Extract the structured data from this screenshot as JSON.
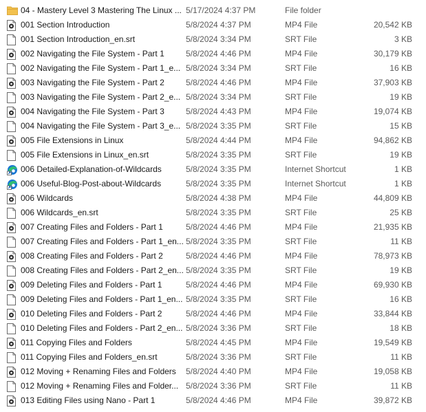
{
  "files": [
    {
      "name": "04 - Mastery Level 3 Mastering The Linux ...",
      "date": "5/17/2024 4:37 PM",
      "type": "File folder",
      "size": "",
      "icon": "folder-icon"
    },
    {
      "name": "001 Section Introduction",
      "date": "5/8/2024 4:37 PM",
      "type": "MP4 File",
      "size": "20,542 KB",
      "icon": "video-file-icon"
    },
    {
      "name": "001 Section Introduction_en.srt",
      "date": "5/8/2024 3:34 PM",
      "type": "SRT File",
      "size": "3 KB",
      "icon": "document-icon"
    },
    {
      "name": "002 Navigating the File System - Part 1",
      "date": "5/8/2024 4:46 PM",
      "type": "MP4 File",
      "size": "30,179 KB",
      "icon": "video-file-icon"
    },
    {
      "name": "002 Navigating the File System - Part 1_e...",
      "date": "5/8/2024 3:34 PM",
      "type": "SRT File",
      "size": "16 KB",
      "icon": "document-icon"
    },
    {
      "name": "003 Navigating the File System - Part 2",
      "date": "5/8/2024 4:46 PM",
      "type": "MP4 File",
      "size": "37,903 KB",
      "icon": "video-file-icon"
    },
    {
      "name": "003 Navigating the File System - Part 2_e...",
      "date": "5/8/2024 3:34 PM",
      "type": "SRT File",
      "size": "19 KB",
      "icon": "document-icon"
    },
    {
      "name": "004 Navigating the File System - Part 3",
      "date": "5/8/2024 4:43 PM",
      "type": "MP4 File",
      "size": "19,074 KB",
      "icon": "video-file-icon"
    },
    {
      "name": "004 Navigating the File System - Part 3_e...",
      "date": "5/8/2024 3:35 PM",
      "type": "SRT File",
      "size": "15 KB",
      "icon": "document-icon"
    },
    {
      "name": "005 File Extensions in Linux",
      "date": "5/8/2024 4:44 PM",
      "type": "MP4 File",
      "size": "94,862 KB",
      "icon": "video-file-icon"
    },
    {
      "name": "005 File Extensions in Linux_en.srt",
      "date": "5/8/2024 3:35 PM",
      "type": "SRT File",
      "size": "19 KB",
      "icon": "document-icon"
    },
    {
      "name": "006 Detailed-Explanation-of-Wildcards",
      "date": "5/8/2024 3:35 PM",
      "type": "Internet Shortcut",
      "size": "1 KB",
      "icon": "internet-shortcut-icon"
    },
    {
      "name": "006 Useful-Blog-Post-about-Wildcards",
      "date": "5/8/2024 3:35 PM",
      "type": "Internet Shortcut",
      "size": "1 KB",
      "icon": "internet-shortcut-icon"
    },
    {
      "name": "006 Wildcards",
      "date": "5/8/2024 4:38 PM",
      "type": "MP4 File",
      "size": "44,809 KB",
      "icon": "video-file-icon"
    },
    {
      "name": "006 Wildcards_en.srt",
      "date": "5/8/2024 3:35 PM",
      "type": "SRT File",
      "size": "25 KB",
      "icon": "document-icon"
    },
    {
      "name": "007 Creating Files and Folders - Part 1",
      "date": "5/8/2024 4:46 PM",
      "type": "MP4 File",
      "size": "21,935 KB",
      "icon": "video-file-icon"
    },
    {
      "name": "007 Creating Files and Folders - Part 1_en...",
      "date": "5/8/2024 3:35 PM",
      "type": "SRT File",
      "size": "11 KB",
      "icon": "document-icon"
    },
    {
      "name": "008 Creating Files and Folders - Part 2",
      "date": "5/8/2024 4:46 PM",
      "type": "MP4 File",
      "size": "78,973 KB",
      "icon": "video-file-icon"
    },
    {
      "name": "008 Creating Files and Folders - Part 2_en...",
      "date": "5/8/2024 3:35 PM",
      "type": "SRT File",
      "size": "19 KB",
      "icon": "document-icon"
    },
    {
      "name": "009 Deleting Files and Folders - Part 1",
      "date": "5/8/2024 4:46 PM",
      "type": "MP4 File",
      "size": "69,930 KB",
      "icon": "video-file-icon"
    },
    {
      "name": "009 Deleting Files and Folders - Part 1_en...",
      "date": "5/8/2024 3:35 PM",
      "type": "SRT File",
      "size": "16 KB",
      "icon": "document-icon"
    },
    {
      "name": "010 Deleting Files and Folders - Part 2",
      "date": "5/8/2024 4:46 PM",
      "type": "MP4 File",
      "size": "33,844 KB",
      "icon": "video-file-icon"
    },
    {
      "name": "010 Deleting Files and Folders - Part 2_en...",
      "date": "5/8/2024 3:36 PM",
      "type": "SRT File",
      "size": "18 KB",
      "icon": "document-icon"
    },
    {
      "name": "011 Copying Files and Folders",
      "date": "5/8/2024 4:45 PM",
      "type": "MP4 File",
      "size": "19,549 KB",
      "icon": "video-file-icon"
    },
    {
      "name": "011 Copying Files and Folders_en.srt",
      "date": "5/8/2024 3:36 PM",
      "type": "SRT File",
      "size": "11 KB",
      "icon": "document-icon"
    },
    {
      "name": "012 Moving + Renaming Files and Folders",
      "date": "5/8/2024 4:40 PM",
      "type": "MP4 File",
      "size": "19,058 KB",
      "icon": "video-file-icon"
    },
    {
      "name": "012 Moving + Renaming Files and Folder...",
      "date": "5/8/2024 3:36 PM",
      "type": "SRT File",
      "size": "11 KB",
      "icon": "document-icon"
    },
    {
      "name": "013 Editing Files using Nano - Part 1",
      "date": "5/8/2024 4:46 PM",
      "type": "MP4 File",
      "size": "39,872 KB",
      "icon": "video-file-icon"
    }
  ],
  "colors": {
    "folder": "#f2c14e",
    "folder_dark": "#dca83a",
    "video_ring": "#333333",
    "doc_border": "#6b6b6b",
    "edge_blue": "#1877d3",
    "edge_teal": "#2fbf71"
  }
}
